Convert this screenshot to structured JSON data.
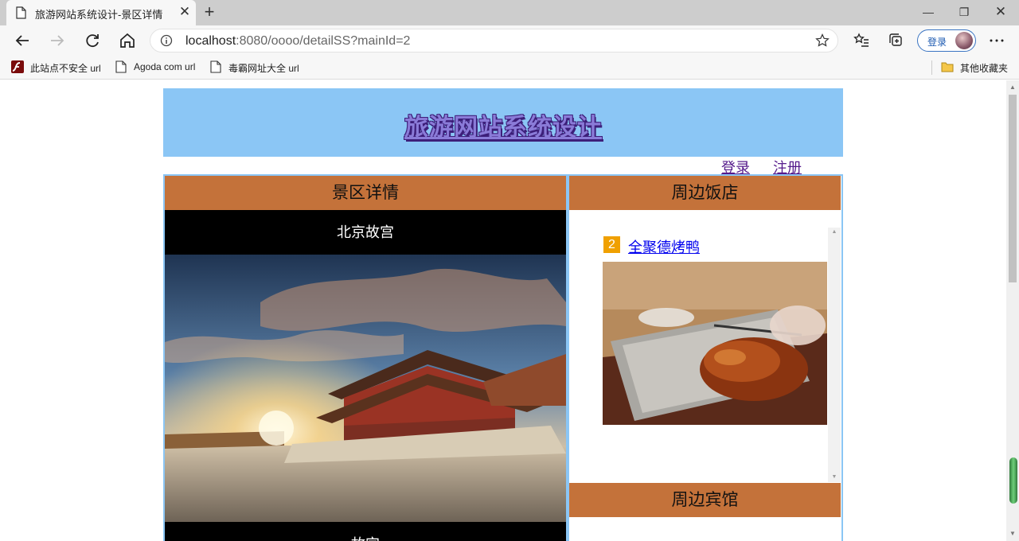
{
  "browser": {
    "tab_title": "旅游网站系统设计-景区详情",
    "url_host": "localhost",
    "url_rest": ":8080/oooo/detailSS?mainId=2",
    "profile_button": "登录",
    "bookmarks": [
      {
        "label": "此站点不安全 url",
        "icon": "flash-icon"
      },
      {
        "label": "Agoda com url",
        "icon": "page-icon"
      },
      {
        "label": "毒霸网址大全 url",
        "icon": "page-icon"
      }
    ],
    "other_bookmarks": "其他收藏夹"
  },
  "site": {
    "title": "旅游网站系统设计",
    "login_link": "登录",
    "register_link": "注册"
  },
  "detail_panel": {
    "header": "景区详情",
    "spot_name": "北京故宫",
    "caption": "故宫"
  },
  "restaurant_panel": {
    "header": "周边饭店",
    "items": [
      {
        "rank": "2",
        "name": "全聚德烤鸭"
      }
    ]
  },
  "hotel_panel": {
    "header": "周边宾馆"
  },
  "colors": {
    "banner": "#8bc6f5",
    "panel_header": "#c4723a",
    "rank_badge": "#f0a000"
  }
}
